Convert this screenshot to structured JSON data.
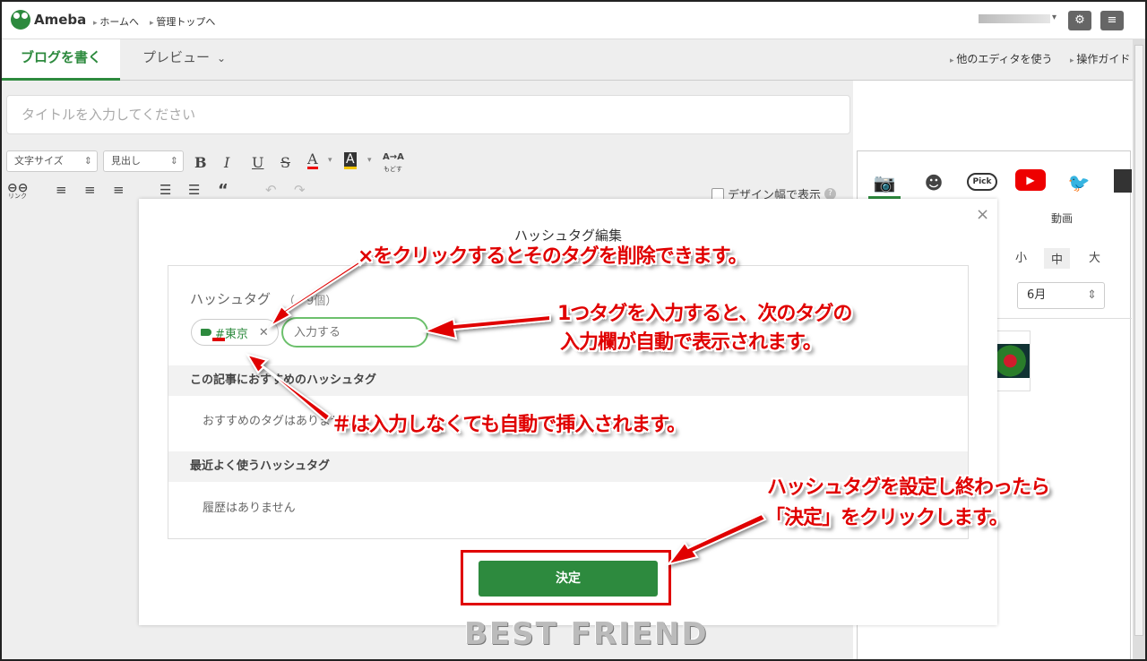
{
  "header": {
    "brand": "Ameba",
    "links": [
      "ホームへ",
      "管理トップへ"
    ],
    "settings_icon": "gear-icon",
    "menu_icon": "menu-icon"
  },
  "tabs": {
    "write": "ブログを書く",
    "preview": "プレビュー",
    "other_editor": "他のエディタを使う",
    "guide": "操作ガイド"
  },
  "editor": {
    "title_placeholder": "タイトルを入力してください",
    "font_size": "文字サイズ",
    "heading": "見出し",
    "link_label": "リンク",
    "undo_label": "もどす",
    "design_width": "デザイン幅で表示"
  },
  "side_panel": {
    "pick_label": "Pick",
    "video_label": "動画",
    "sizes": [
      "小",
      "中",
      "大"
    ],
    "month": "6月"
  },
  "modal": {
    "title": "ハッシュタグ編集",
    "hashtag_label": "ハッシュタグ",
    "count_text": "（　9個）",
    "chip_text": "#東京",
    "input_placeholder": "入力する",
    "recommended_title": "この記事におすすめのハッシュタグ",
    "recommended_empty": "おすすめのタグはありません",
    "recent_title": "最近よく使うハッシュタグ",
    "recent_empty": "履歴はありません",
    "decide_button": "決定"
  },
  "annotations": {
    "delete_note": "×をクリックするとそのタグを削除できます。",
    "next_input_note_1": "1つタグを入力すると、次のタグの",
    "next_input_note_2": "入力欄が自動で表示されます。",
    "hash_note": "＃は入力しなくても自動で挿入されます。",
    "finish_note_1": "ハッシュタグを設定し終わったら",
    "finish_note_2": "「決定」をクリックします。"
  },
  "watermark": "BEST  FRIEND",
  "colors": {
    "accent": "#2d8a3e",
    "annotation": "#e00000"
  }
}
